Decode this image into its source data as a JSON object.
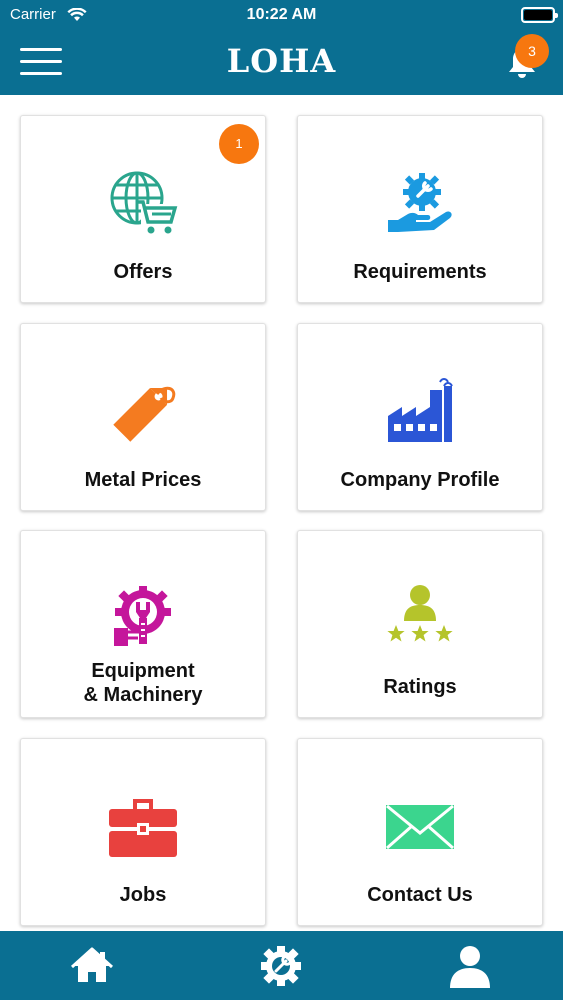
{
  "status_bar": {
    "carrier": "Carrier",
    "time": "10:22 AM"
  },
  "header": {
    "title": "LOHA",
    "notification_count": "3"
  },
  "tiles": [
    {
      "label": "Offers",
      "icon": "globe-cart-icon",
      "color": "#2aa58d",
      "badge": "1"
    },
    {
      "label": "Requirements",
      "icon": "hand-gear-icon",
      "color": "#1b9ae0"
    },
    {
      "label": "Metal Prices",
      "icon": "price-tag-icon",
      "color": "#f47b20"
    },
    {
      "label": "Company Profile",
      "icon": "factory-icon",
      "color": "#2b56d6"
    },
    {
      "label_line1": "Equipment",
      "label_line2": "& Machinery",
      "icon": "machinery-gear-icon",
      "color": "#c4169b"
    },
    {
      "label": "Ratings",
      "icon": "person-stars-icon",
      "color": "#b5c42b"
    },
    {
      "label": "Jobs",
      "icon": "briefcase-icon",
      "color": "#e8413e"
    },
    {
      "label": "Contact Us",
      "icon": "envelope-icon",
      "color": "#3bd58e"
    }
  ],
  "tab_bar": {
    "items": [
      "home-icon",
      "settings-icon",
      "profile-icon"
    ]
  }
}
